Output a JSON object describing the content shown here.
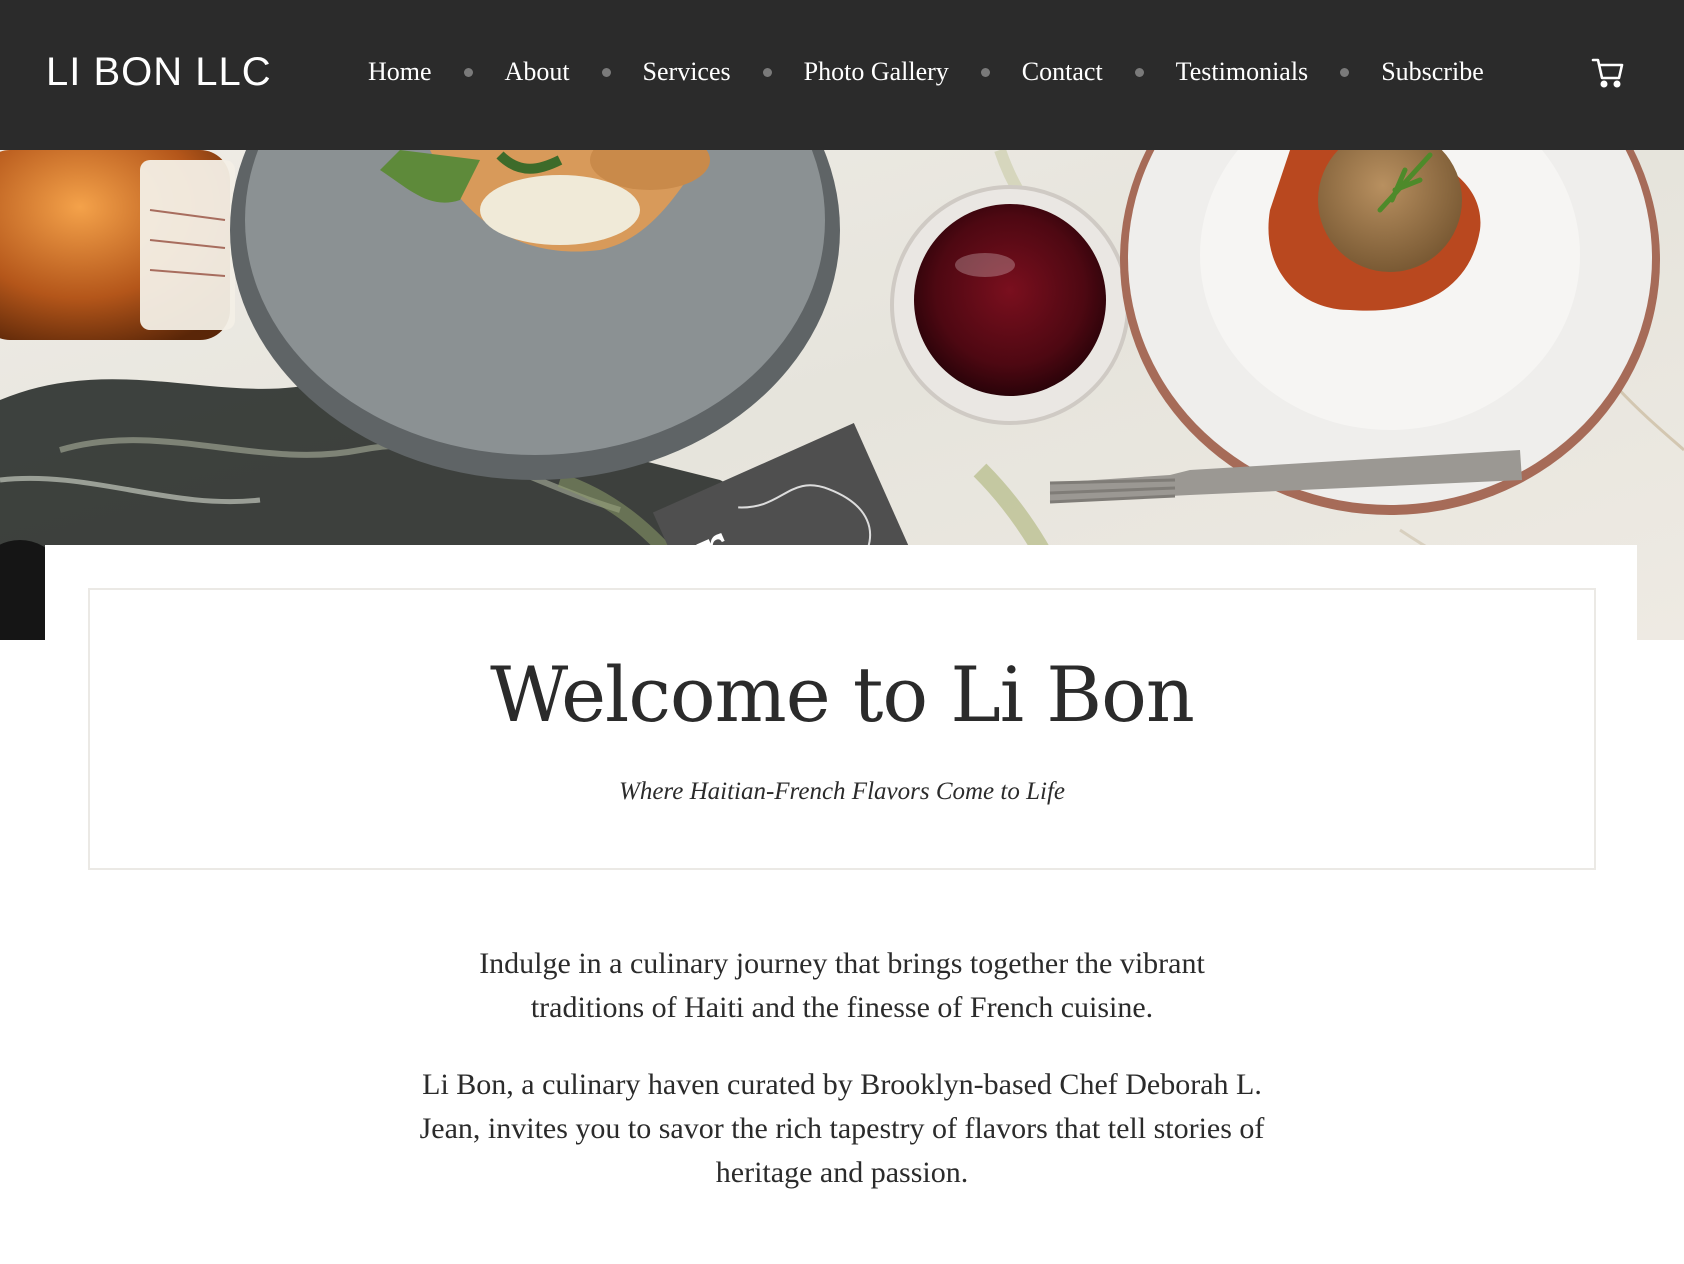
{
  "header": {
    "logo": "LI BON LLC",
    "nav": [
      {
        "label": "Home"
      },
      {
        "label": "About"
      },
      {
        "label": "Services"
      },
      {
        "label": "Photo Gallery"
      },
      {
        "label": "Contact"
      },
      {
        "label": "Testimonials"
      },
      {
        "label": "Subscribe"
      }
    ],
    "cart_icon": "shopping-cart-icon"
  },
  "hero": {
    "image": "food-table-photo",
    "menu_card_letter": "r"
  },
  "welcome": {
    "title": "Welcome to Li Bon",
    "subtitle": "Where Haitian-French Flavors Come to Life"
  },
  "body": {
    "paragraph_1": "Indulge in a culinary journey that brings together the vibrant traditions of Haiti and the finesse of French cuisine.",
    "paragraph_2": "Li Bon, a culinary haven curated by Brooklyn-based Chef Deborah L. Jean, invites you to savor the rich tapestry of flavors that tell stories of heritage and passion."
  },
  "colors": {
    "header_bg": "#2b2b2b",
    "text": "#2b2b2b",
    "nav_dot": "#7a7a7a",
    "card_border": "#ebe9e5"
  }
}
